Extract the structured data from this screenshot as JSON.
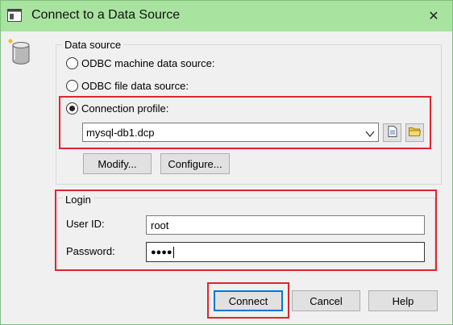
{
  "window": {
    "title": "Connect to a Data Source",
    "close_glyph": "✕",
    "icons": {
      "app": "app-window-icon",
      "database": "database-icon",
      "close": "close-icon"
    }
  },
  "data_source": {
    "group_label": "Data source",
    "options": [
      {
        "label": "ODBC machine data source:",
        "selected": false
      },
      {
        "label": "ODBC file data source:",
        "selected": false
      },
      {
        "label": "Connection profile:",
        "selected": true
      }
    ],
    "profile_value": "mysql-db1.dcp",
    "modify_label": "Modify...",
    "configure_label": "Configure...",
    "icons": {
      "dropdown": "chevron-down-icon",
      "new_file": "new-file-icon",
      "browse": "folder-icon"
    }
  },
  "login": {
    "group_label": "Login",
    "user_id_label": "User ID:",
    "user_id_value": "root",
    "password_label": "Password:",
    "password_value": "●●●●"
  },
  "buttons": {
    "connect": "Connect",
    "cancel": "Cancel",
    "help": "Help"
  },
  "colors": {
    "titlebar": "#a9e3a0",
    "highlight_box": "#e0242e",
    "default_button_border": "#0078d7"
  }
}
